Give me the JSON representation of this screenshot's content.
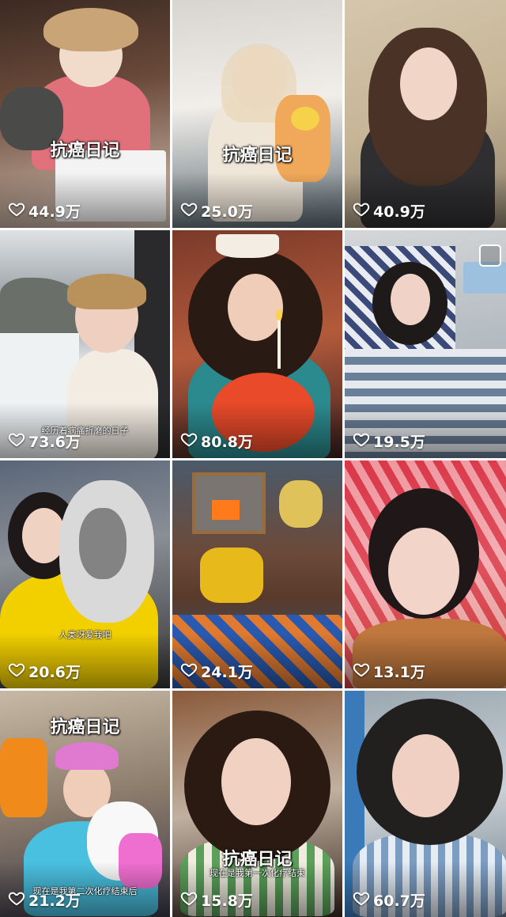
{
  "feed": {
    "tiles": [
      {
        "likes": "44.9万",
        "title": "抗癌日记",
        "subtitle": ""
      },
      {
        "likes": "25.0万",
        "title": "抗癌日记",
        "subtitle": ""
      },
      {
        "likes": "40.9万",
        "title": "",
        "subtitle": ""
      },
      {
        "likes": "73.6万",
        "title": "",
        "subtitle": "经历着病痛折磨的日子"
      },
      {
        "likes": "80.8万",
        "title": "",
        "subtitle": ""
      },
      {
        "likes": "19.5万",
        "title": "",
        "subtitle": ""
      },
      {
        "likes": "20.6万",
        "title": "",
        "subtitle": "人类呀爱我吧"
      },
      {
        "likes": "24.1万",
        "title": "",
        "subtitle": ""
      },
      {
        "likes": "13.1万",
        "title": "",
        "subtitle": ""
      },
      {
        "likes": "21.2万",
        "title": "抗癌日记",
        "subtitle": "现在是我第二次化疗结束后"
      },
      {
        "likes": "15.8万",
        "title": "抗癌日记",
        "subtitle": "现在是我第一次化疗结束"
      },
      {
        "likes": "60.7万",
        "title": "",
        "subtitle": ""
      }
    ]
  },
  "icons": {
    "like": "heart-outline-icon"
  },
  "colors": {
    "text": "#ffffff",
    "background": "#ffffff"
  }
}
